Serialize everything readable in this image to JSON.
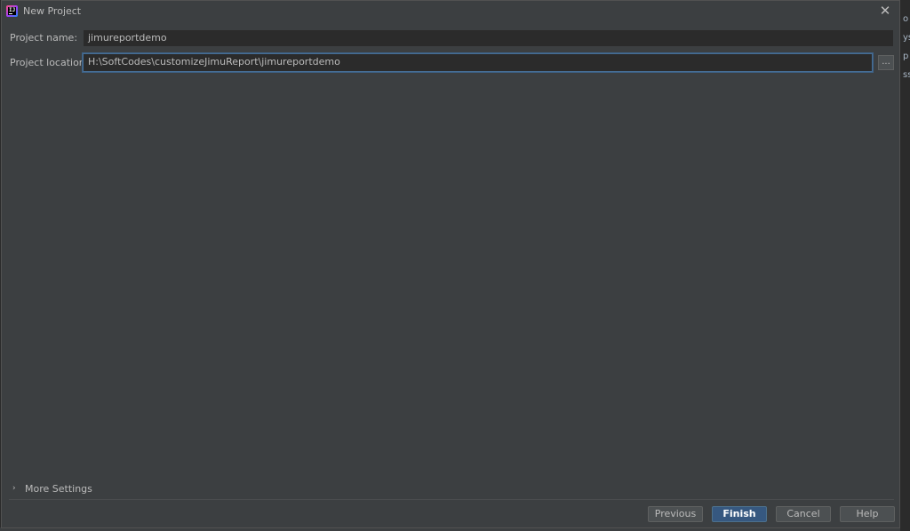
{
  "window": {
    "title": "New Project",
    "close_symbol": "✕"
  },
  "form": {
    "project_name_label": "Project name:",
    "project_name_value": "jimureportdemo",
    "project_location_label": "Project location:",
    "project_location_value": "H:\\SoftCodes\\customizeJimuReport\\jimureportdemo",
    "browse_label": "..."
  },
  "more_settings": {
    "chevron": "›",
    "label": "More Settings"
  },
  "buttons": {
    "previous": "Previous",
    "finish": "Finish",
    "cancel": "Cancel",
    "help": "Help"
  },
  "background_edge": {
    "glyphs": [
      "o",
      "ys",
      "p",
      "ss"
    ]
  },
  "colors": {
    "dialog_bg": "#3c3f41",
    "field_bg": "#2b2b2b",
    "focus_border": "#466d94",
    "primary_button": "#365880",
    "text": "#bbbbbb"
  },
  "icons": {
    "app": "intellij-idea-icon",
    "close": "close-icon",
    "more_settings": "chevron-right-icon"
  }
}
